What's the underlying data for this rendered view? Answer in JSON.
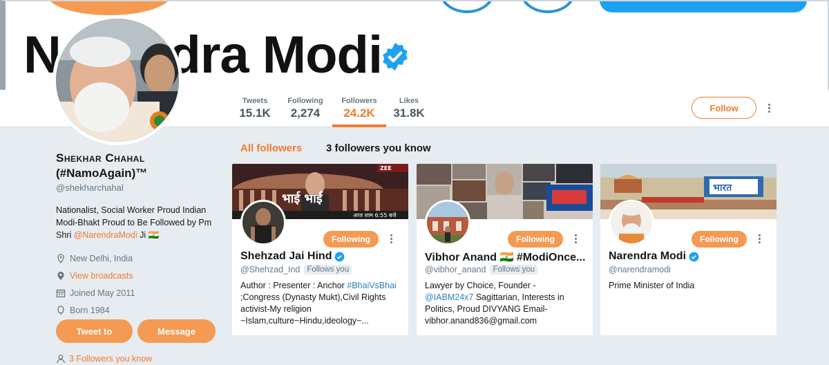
{
  "header": {
    "banner_name": "Narendra Modi",
    "verified_icon": "verified-badge-icon"
  },
  "stats": [
    {
      "label": "Tweets",
      "value": "15.1K"
    },
    {
      "label": "Following",
      "value": "2,274"
    },
    {
      "label": "Followers",
      "value": "24.2K"
    },
    {
      "label": "Likes",
      "value": "31.8K"
    }
  ],
  "follow_label": "Follow",
  "profile": {
    "name_line1": "Shekhar Chahal",
    "name_line2": "(#NamoAgain)™",
    "handle": "@shekharchahal",
    "bio_line1": "Nationalist, Social Worker Proud Indian",
    "bio_line2": "Modi-Bhakt Proud to Be Followed by Pm",
    "bio_prefix": "Shri ",
    "bio_mention": "@NarendraModi",
    "bio_suffix": " Ji 🇮🇳",
    "location": "New Delhi, India",
    "broadcasts": "View broadcasts",
    "joined": "Joined May 2011",
    "born": "Born 1984",
    "tweet_to": "Tweet to",
    "message": "Message",
    "followers_you_know": "3 Followers you know"
  },
  "tabs": {
    "all": "All followers",
    "known": "3 followers you know"
  },
  "cards": [
    {
      "name": "Shehzad Jai Hind",
      "verified": true,
      "handle": "@Shehzad_Ind",
      "follows_you": "Follows you",
      "button": "Following",
      "bio_a": "Author : Presenter : Anchor ",
      "bio_tag": "#BhaiVsBhai",
      "bio_b": " ;Congress (Dynasty Mukt),Civil Rights activist-My religion ~Islam,culture~Hindu,ideology~...",
      "banner_text": "भाई भाई",
      "banner_sub": "आज शाम 6:55 बजे",
      "banner_tag": "ZEE"
    },
    {
      "name": "Vibhor Anand 🇮🇳 #ModiOnce...",
      "verified": false,
      "handle": "@vibhor_anand",
      "follows_you": "Follows you",
      "button": "Following",
      "bio_a": "Lawyer by Choice, Founder - ",
      "bio_tag": "@IABM24x7",
      "bio_b": " Sagittarian, Interests in Politics, Proud DIVYANG Email- vibhor.anand836@gmail.com"
    },
    {
      "name": "Narendra Modi",
      "verified": true,
      "handle": "@narendramodi",
      "button": "Following",
      "bio_a": "Prime Minister of India",
      "banner_text": "भारत"
    }
  ],
  "colors": {
    "accent": "#f27a2f",
    "button_fill": "#f59a52",
    "verified": "#1da1f2",
    "background": "#e6ecf0"
  }
}
